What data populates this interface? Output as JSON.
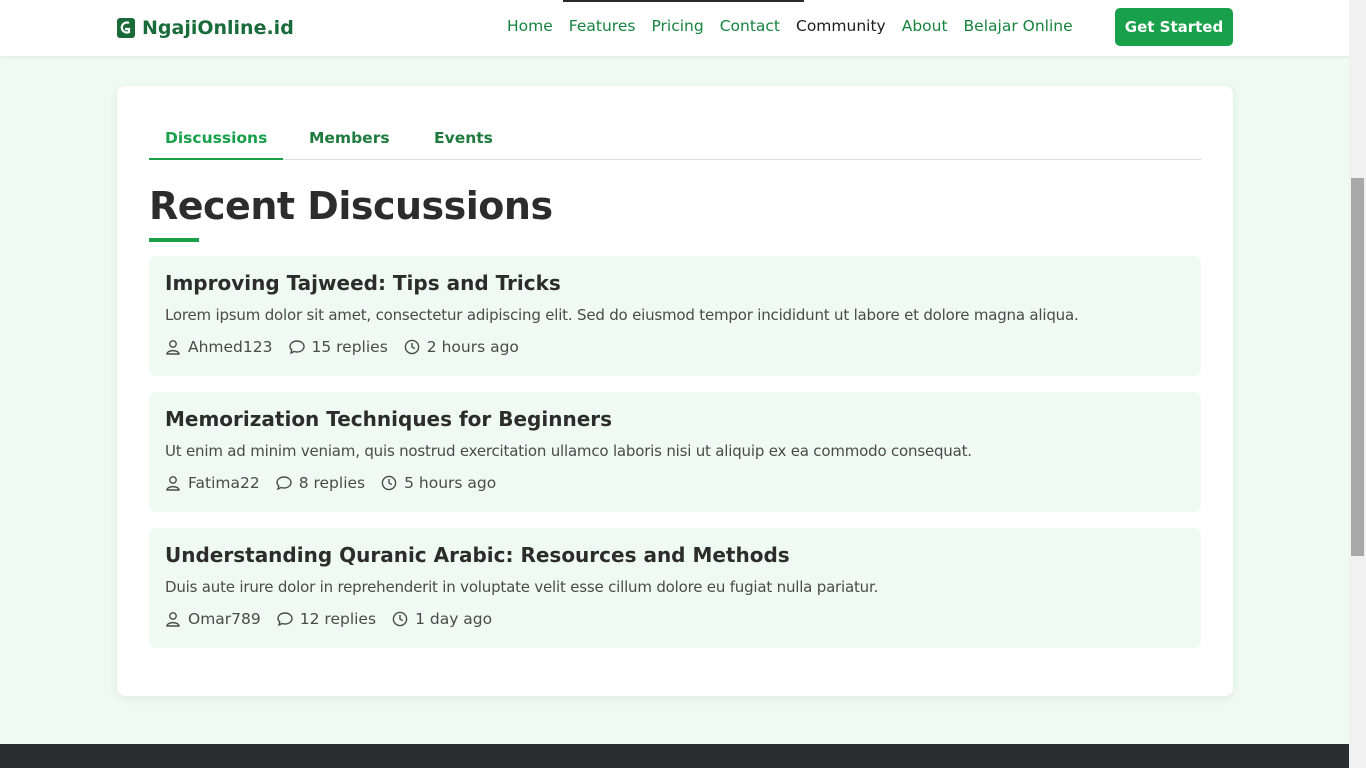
{
  "brand": {
    "name": "NgajiOnline.id",
    "color": "#1a6b3a"
  },
  "nav": {
    "links": [
      {
        "label": "Home"
      },
      {
        "label": "Features"
      },
      {
        "label": "Pricing"
      },
      {
        "label": "Contact"
      },
      {
        "label": "Community",
        "active": true
      },
      {
        "label": "About"
      },
      {
        "label": "Belajar Online"
      }
    ],
    "cta_label": "Get Started"
  },
  "tabs": [
    {
      "label": "Discussions",
      "active": true
    },
    {
      "label": "Members"
    },
    {
      "label": "Events"
    }
  ],
  "section": {
    "title": "Recent Discussions"
  },
  "discussions": [
    {
      "title": "Improving Tajweed: Tips and Tricks",
      "excerpt": "Lorem ipsum dolor sit amet, consectetur adipiscing elit. Sed do eiusmod tempor incididunt ut labore et dolore magna aliqua.",
      "author": "Ahmed123",
      "replies": "15 replies",
      "time": "2 hours ago"
    },
    {
      "title": "Memorization Techniques for Beginners",
      "excerpt": "Ut enim ad minim veniam, quis nostrud exercitation ullamco laboris nisi ut aliquip ex ea commodo consequat.",
      "author": "Fatima22",
      "replies": "8 replies",
      "time": "5 hours ago"
    },
    {
      "title": "Understanding Quranic Arabic: Resources and Methods",
      "excerpt": "Duis aute irure dolor in reprehenderit in voluptate velit esse cillum dolore eu fugiat nulla pariatur.",
      "author": "Omar789",
      "replies": "12 replies",
      "time": "1 day ago"
    }
  ],
  "colors": {
    "accent": "#18a04a",
    "link": "#16843e",
    "page_bg": "#effbf2",
    "footer_bg": "#2b2c30"
  },
  "icons": {
    "logo": "quran-book-icon",
    "author": "user-icon",
    "replies": "comment-icon",
    "time": "clock-icon"
  }
}
